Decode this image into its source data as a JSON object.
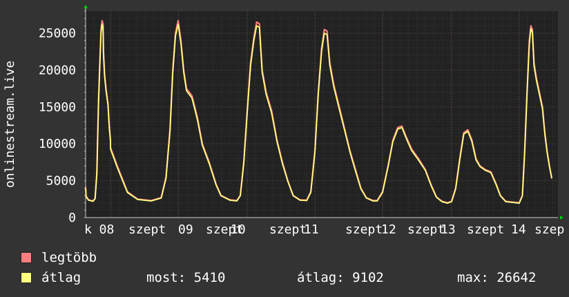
{
  "chart_data": {
    "type": "area",
    "ylabel": "onlinestream.live",
    "ylim": [
      0,
      28000
    ],
    "y_ticks": [
      0,
      5000,
      10000,
      15000,
      20000,
      25000
    ],
    "x_tick_labels": [
      "k 08",
      "szept",
      "09",
      "szept",
      "10",
      "szept",
      "11",
      "szept",
      "12",
      "szept",
      "13",
      "szept",
      "14",
      "szep"
    ],
    "grid": true,
    "series": [
      {
        "name": "legtöbb",
        "color": "#ff7f7f",
        "days": [
          [
            [
              0,
              4200
            ],
            [
              0.02,
              2900
            ],
            [
              0.12,
              2400
            ],
            [
              0.3,
              2250
            ],
            [
              0.38,
              2600
            ],
            [
              0.45,
              6000
            ],
            [
              0.52,
              16000
            ],
            [
              0.58,
              22000
            ],
            [
              0.62,
              25500
            ],
            [
              0.66,
              26700
            ],
            [
              0.7,
              26300
            ],
            [
              0.72,
              22500
            ],
            [
              0.76,
              19500
            ],
            [
              0.82,
              17500
            ],
            [
              0.9,
              15500
            ],
            [
              0.95,
              12500
            ],
            [
              1.0,
              10500
            ]
          ],
          [
            [
              0,
              9500
            ],
            [
              0.1,
              7000
            ],
            [
              0.25,
              3500
            ],
            [
              0.4,
              2500
            ],
            [
              0.6,
              2300
            ],
            [
              0.75,
              2700
            ],
            [
              0.82,
              5500
            ],
            [
              0.88,
              12000
            ],
            [
              0.92,
              20000
            ],
            [
              0.96,
              25000
            ],
            [
              1.0,
              26700
            ]
          ],
          [
            [
              0,
              26700
            ],
            [
              0.04,
              24000
            ],
            [
              0.08,
              20000
            ],
            [
              0.12,
              17500
            ],
            [
              0.2,
              16500
            ],
            [
              0.28,
              13500
            ],
            [
              0.35,
              10000
            ],
            [
              0.45,
              7500
            ],
            [
              0.55,
              4500
            ],
            [
              0.62,
              3000
            ],
            [
              0.75,
              2400
            ],
            [
              0.85,
              2300
            ],
            [
              0.9,
              3000
            ],
            [
              0.95,
              7500
            ],
            [
              1.0,
              14500
            ]
          ],
          [
            [
              0,
              14500
            ],
            [
              0.05,
              21000
            ],
            [
              0.1,
              24500
            ],
            [
              0.14,
              26500
            ],
            [
              0.18,
              26300
            ],
            [
              0.22,
              20000
            ],
            [
              0.28,
              17000
            ],
            [
              0.36,
              14500
            ],
            [
              0.44,
              10500
            ],
            [
              0.52,
              7500
            ],
            [
              0.6,
              5000
            ],
            [
              0.68,
              3000
            ],
            [
              0.78,
              2400
            ],
            [
              0.88,
              2350
            ],
            [
              0.94,
              3500
            ],
            [
              1.0,
              9000
            ]
          ],
          [
            [
              0,
              9000
            ],
            [
              0.05,
              17000
            ],
            [
              0.1,
              23000
            ],
            [
              0.14,
              25500
            ],
            [
              0.18,
              25300
            ],
            [
              0.22,
              21000
            ],
            [
              0.28,
              18000
            ],
            [
              0.36,
              15000
            ],
            [
              0.44,
              12000
            ],
            [
              0.52,
              9000
            ],
            [
              0.6,
              6500
            ],
            [
              0.68,
              4000
            ],
            [
              0.76,
              2700
            ],
            [
              0.86,
              2300
            ],
            [
              0.92,
              2300
            ],
            [
              1.0,
              3500
            ]
          ],
          [
            [
              0,
              3500
            ],
            [
              0.08,
              7000
            ],
            [
              0.15,
              10500
            ],
            [
              0.22,
              12200
            ],
            [
              0.28,
              12400
            ],
            [
              0.34,
              11000
            ],
            [
              0.42,
              9300
            ],
            [
              0.52,
              8000
            ],
            [
              0.62,
              6500
            ],
            [
              0.7,
              4500
            ],
            [
              0.78,
              2800
            ],
            [
              0.86,
              2200
            ],
            [
              0.94,
              2000
            ],
            [
              1.0,
              2200
            ]
          ],
          [
            [
              0,
              2200
            ],
            [
              0.06,
              4000
            ],
            [
              0.12,
              8000
            ],
            [
              0.18,
              11500
            ],
            [
              0.24,
              11900
            ],
            [
              0.3,
              10500
            ],
            [
              0.36,
              8000
            ],
            [
              0.42,
              7000
            ],
            [
              0.5,
              6500
            ],
            [
              0.58,
              6200
            ],
            [
              0.66,
              4500
            ],
            [
              0.72,
              3000
            ],
            [
              0.8,
              2200
            ],
            [
              0.9,
              2100
            ],
            [
              1.0,
              2000
            ]
          ],
          [
            [
              0,
              2000
            ],
            [
              0.08,
              3000
            ],
            [
              0.14,
              9000
            ],
            [
              0.2,
              17000
            ],
            [
              0.26,
              24000
            ],
            [
              0.3,
              26000
            ],
            [
              0.34,
              25500
            ],
            [
              0.38,
              21000
            ],
            [
              0.44,
              19000
            ],
            [
              0.52,
              17000
            ],
            [
              0.6,
              15000
            ],
            [
              0.66,
              11500
            ],
            [
              0.72,
              9000
            ],
            [
              0.78,
              7000
            ],
            [
              0.84,
              5400
            ]
          ]
        ]
      },
      {
        "name": "átlag",
        "color": "#ffff80",
        "days": [
          [
            [
              0,
              4000
            ],
            [
              0.02,
              2800
            ],
            [
              0.12,
              2350
            ],
            [
              0.3,
              2200
            ],
            [
              0.38,
              2550
            ],
            [
              0.45,
              5800
            ],
            [
              0.52,
              15500
            ],
            [
              0.58,
              21500
            ],
            [
              0.62,
              25000
            ],
            [
              0.66,
              26200
            ],
            [
              0.7,
              25800
            ],
            [
              0.72,
              22000
            ],
            [
              0.76,
              19200
            ],
            [
              0.82,
              17200
            ],
            [
              0.9,
              15200
            ],
            [
              0.95,
              12200
            ],
            [
              1.0,
              10300
            ]
          ],
          [
            [
              0,
              9300
            ],
            [
              0.1,
              6800
            ],
            [
              0.25,
              3400
            ],
            [
              0.4,
              2450
            ],
            [
              0.6,
              2250
            ],
            [
              0.75,
              2650
            ],
            [
              0.82,
              5300
            ],
            [
              0.88,
              11700
            ],
            [
              0.92,
              19600
            ],
            [
              0.96,
              24600
            ],
            [
              1.0,
              26200
            ]
          ],
          [
            [
              0,
              26200
            ],
            [
              0.04,
              23600
            ],
            [
              0.08,
              19700
            ],
            [
              0.12,
              17200
            ],
            [
              0.2,
              16200
            ],
            [
              0.28,
              13200
            ],
            [
              0.35,
              9800
            ],
            [
              0.45,
              7300
            ],
            [
              0.55,
              4400
            ],
            [
              0.62,
              2950
            ],
            [
              0.75,
              2350
            ],
            [
              0.85,
              2250
            ],
            [
              0.9,
              2950
            ],
            [
              0.95,
              7300
            ],
            [
              1.0,
              14200
            ]
          ],
          [
            [
              0,
              14200
            ],
            [
              0.05,
              20600
            ],
            [
              0.1,
              24100
            ],
            [
              0.14,
              26000
            ],
            [
              0.18,
              25800
            ],
            [
              0.22,
              19700
            ],
            [
              0.28,
              16700
            ],
            [
              0.36,
              14200
            ],
            [
              0.44,
              10300
            ],
            [
              0.52,
              7300
            ],
            [
              0.6,
              4900
            ],
            [
              0.68,
              2950
            ],
            [
              0.78,
              2350
            ],
            [
              0.88,
              2300
            ],
            [
              0.94,
              3400
            ],
            [
              1.0,
              8800
            ]
          ],
          [
            [
              0,
              8800
            ],
            [
              0.05,
              16700
            ],
            [
              0.1,
              22600
            ],
            [
              0.14,
              25000
            ],
            [
              0.18,
              24800
            ],
            [
              0.22,
              20600
            ],
            [
              0.28,
              17700
            ],
            [
              0.36,
              14700
            ],
            [
              0.44,
              11800
            ],
            [
              0.52,
              8800
            ],
            [
              0.6,
              6300
            ],
            [
              0.68,
              3900
            ],
            [
              0.76,
              2650
            ],
            [
              0.86,
              2250
            ],
            [
              0.92,
              2250
            ],
            [
              1.0,
              3400
            ]
          ],
          [
            [
              0,
              3400
            ],
            [
              0.08,
              6900
            ],
            [
              0.15,
              10300
            ],
            [
              0.22,
              12000
            ],
            [
              0.28,
              12200
            ],
            [
              0.34,
              10800
            ],
            [
              0.42,
              9100
            ],
            [
              0.52,
              7800
            ],
            [
              0.62,
              6400
            ],
            [
              0.7,
              4400
            ],
            [
              0.78,
              2750
            ],
            [
              0.86,
              2150
            ],
            [
              0.94,
              1950
            ],
            [
              1.0,
              2150
            ]
          ],
          [
            [
              0,
              2150
            ],
            [
              0.06,
              3900
            ],
            [
              0.12,
              7800
            ],
            [
              0.18,
              11300
            ],
            [
              0.24,
              11700
            ],
            [
              0.3,
              10300
            ],
            [
              0.36,
              7800
            ],
            [
              0.42,
              6900
            ],
            [
              0.5,
              6400
            ],
            [
              0.58,
              6100
            ],
            [
              0.66,
              4400
            ],
            [
              0.72,
              2950
            ],
            [
              0.8,
              2150
            ],
            [
              0.9,
              2050
            ],
            [
              1.0,
              1950
            ]
          ],
          [
            [
              0,
              1950
            ],
            [
              0.08,
              2950
            ],
            [
              0.14,
              8800
            ],
            [
              0.2,
              16700
            ],
            [
              0.26,
              23600
            ],
            [
              0.3,
              25600
            ],
            [
              0.34,
              25100
            ],
            [
              0.38,
              20600
            ],
            [
              0.44,
              18700
            ],
            [
              0.52,
              16700
            ],
            [
              0.6,
              14700
            ],
            [
              0.66,
              11300
            ],
            [
              0.72,
              8800
            ],
            [
              0.78,
              6900
            ],
            [
              0.84,
              5300
            ]
          ]
        ]
      }
    ]
  },
  "legend": {
    "items": [
      {
        "label": "legtöbb",
        "color": "#ff7f7f"
      },
      {
        "label": "átlag",
        "color": "#ffff80"
      }
    ]
  },
  "stats": {
    "now_label": "most:",
    "now_value": "5410",
    "avg_label": "átlag:",
    "avg_value": "9102",
    "max_label": "max:",
    "max_value": "26642"
  }
}
